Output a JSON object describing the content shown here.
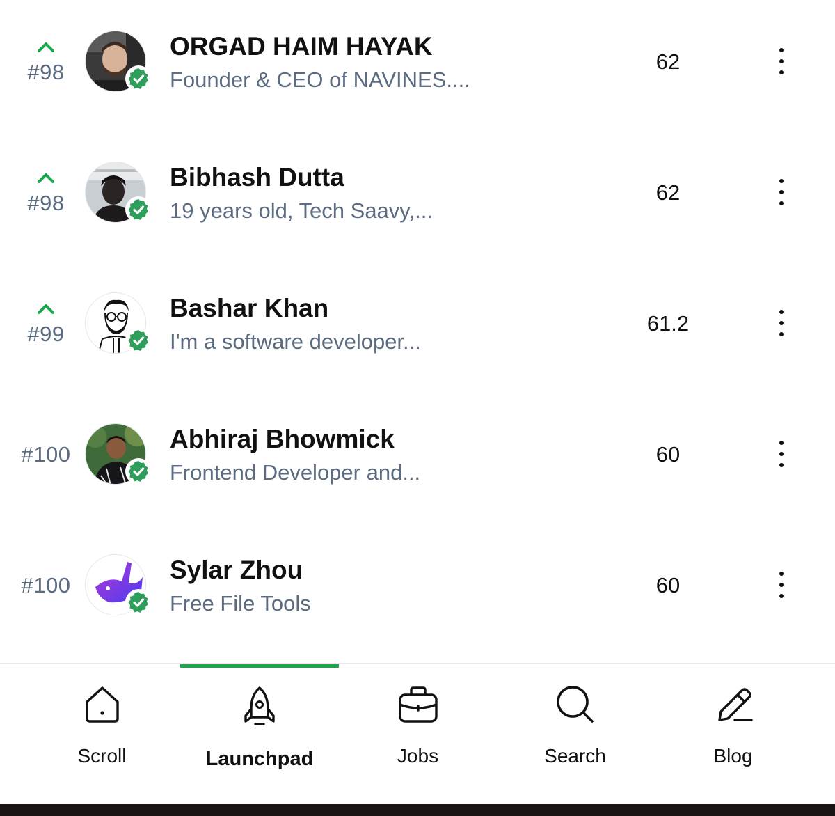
{
  "leaderboard": {
    "rows": [
      {
        "rank": "#98",
        "trend": "up",
        "name": "ORGAD HAIM HAYAK",
        "bio": "Founder & CEO of NAVINES....",
        "score": "62",
        "verified": true
      },
      {
        "rank": "#98",
        "trend": "up",
        "name": "Bibhash Dutta",
        "bio": "19 years old, Tech Saavy,...",
        "score": "62",
        "verified": true
      },
      {
        "rank": "#99",
        "trend": "up",
        "name": "Bashar Khan",
        "bio": "I'm a software developer...",
        "score": "61.2",
        "verified": true
      },
      {
        "rank": "#100",
        "trend": "",
        "name": "Abhiraj Bhowmick",
        "bio": "Frontend Developer and...",
        "score": "60",
        "verified": true
      },
      {
        "rank": "#100",
        "trend": "",
        "name": "Sylar Zhou",
        "bio": "Free File Tools",
        "score": "60",
        "verified": true
      }
    ]
  },
  "bottom_nav": {
    "active": "Launchpad",
    "items": [
      {
        "label": "Scroll",
        "icon": "home-icon"
      },
      {
        "label": "Launchpad",
        "icon": "rocket-icon"
      },
      {
        "label": "Jobs",
        "icon": "briefcase-icon"
      },
      {
        "label": "Search",
        "icon": "search-icon"
      },
      {
        "label": "Blog",
        "icon": "pencil-icon"
      }
    ]
  },
  "colors": {
    "accent_green": "#18a84b",
    "verified_badge": "#2e9e5b",
    "muted_text": "#5b6b80"
  }
}
